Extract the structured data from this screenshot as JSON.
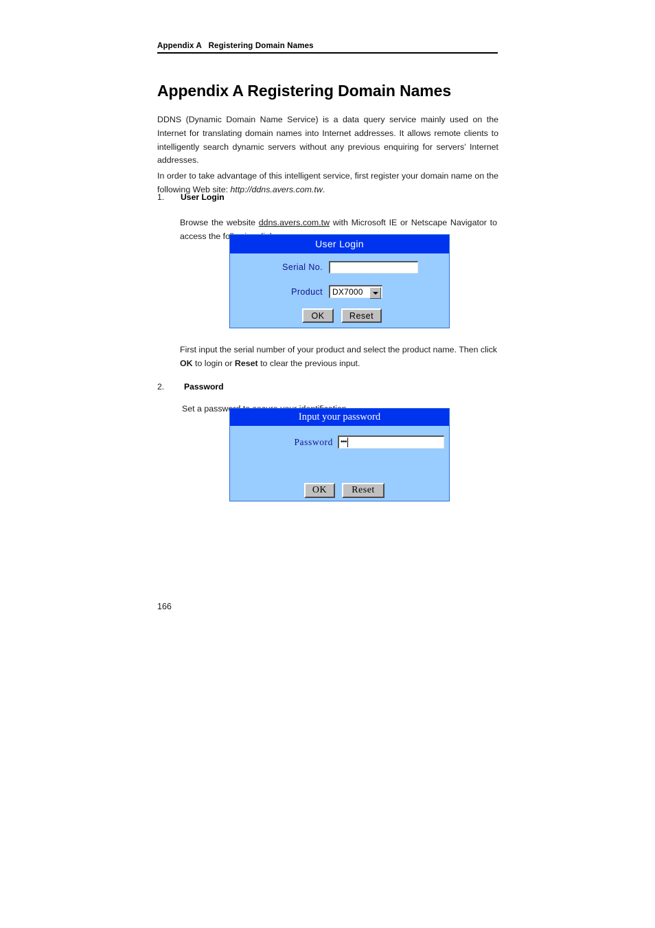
{
  "document": {
    "running_header": "Appendix A   Registering Domain Names",
    "title": "Appendix A Registering Domain Names",
    "page_number": "166"
  },
  "intro": {
    "paragraph_1_part1": "DDNS (Dynamic Domain Name Service) is a data query service mainly used on the Internet for translating domain names into Internet addresses.    It allows remote clients to intelligently search dynamic servers without any previous enquiring for servers’ Internet addresses.",
    "paragraph_2_lead": "In order to take advantage of this intelligent service, first register your domain name on the following Web site: ",
    "paragraph_2_url": "http://ddns.avers.com.tw",
    "paragraph_2_tail": "."
  },
  "steps": [
    {
      "number": "1.",
      "title": "User Login",
      "body_lead": "Browse the website ",
      "body_link": "ddns.avers.com.tw",
      "body_tail": " with Microsoft IE or Netscape Navigator to access the following dialog.",
      "after_lead": "First input the serial number of your product and select the product name. Then click ",
      "after_bold_1": "OK",
      "after_mid": " to login or ",
      "after_bold_2": "Reset",
      "after_tail": " to clear the previous input."
    },
    {
      "number": "2.",
      "title": "Password",
      "body": "Set a password to secure your identification."
    }
  ],
  "login_dialog": {
    "title": "User Login",
    "serial_label": "Serial No.",
    "serial_value": "",
    "serial_placeholder": "",
    "product_label": "Product",
    "product_value": "DX7000",
    "product_options": [
      "DX7000"
    ],
    "ok_label": "OK",
    "reset_label": "Reset",
    "colors": {
      "title_bar": "#0033EE",
      "body": "#99CCFF",
      "label_text": "#11118C",
      "button_face": "#C0C0C0"
    }
  },
  "password_dialog": {
    "title": "Input your password",
    "password_label": "Password",
    "password_value_masked": "•••",
    "ok_label": "OK",
    "reset_label": "Reset",
    "colors": {
      "title_bar": "#0033EE",
      "body": "#99CCFF",
      "label_text": "#11118C",
      "button_face": "#C0C0C0"
    }
  }
}
